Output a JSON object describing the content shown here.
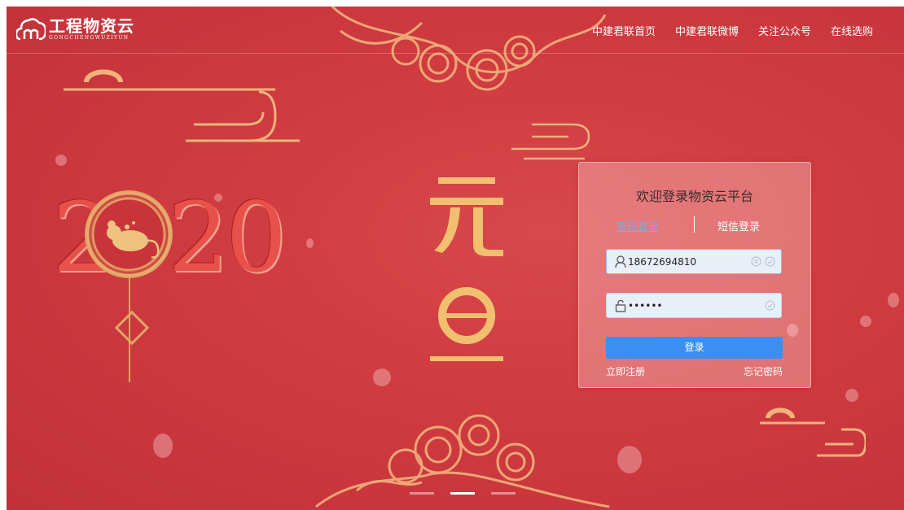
{
  "header": {
    "logo": {
      "title": "工程物资云",
      "subtitle": "GONGCHENGWUZIYUN"
    },
    "nav": [
      "中建君联首页",
      "中建君联微博",
      "关注公众号",
      "在线选购"
    ]
  },
  "banner": {
    "year": "2020",
    "festival_chars": [
      "元",
      "旦"
    ]
  },
  "login": {
    "title": "欢迎登录物资云平台",
    "tabs": {
      "account": "密码登录",
      "sms": "短信登录"
    },
    "username_value": "18672694810",
    "password_value": "••••••",
    "submit_label": "登录",
    "register_label": "立即注册",
    "forgot_label": "忘记密码"
  },
  "carousel": {
    "slides": 3,
    "active_index": 1
  },
  "colors": {
    "background": "#cf3b3f",
    "primary_button": "#3d8ef0",
    "gold": "#e7b46e"
  }
}
